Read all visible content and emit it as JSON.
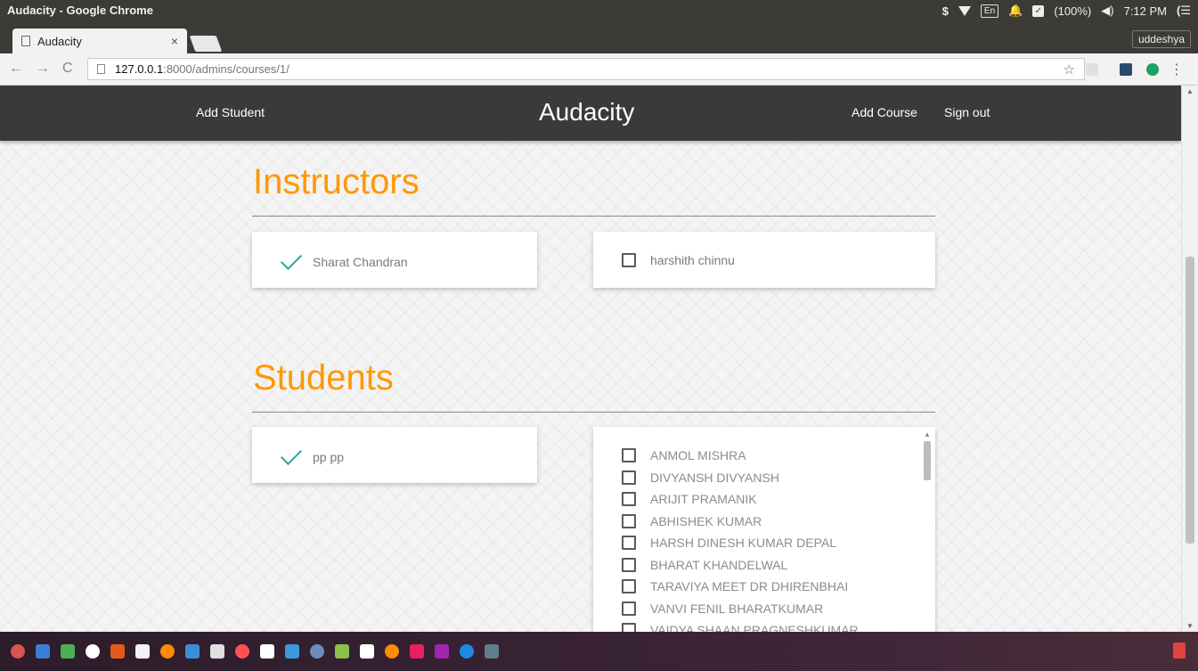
{
  "window": {
    "title": "Audacity - Google Chrome"
  },
  "tray": {
    "lang": "En",
    "battery": "(100%)",
    "volume_icon": "speaker-icon",
    "time": "7:12 PM"
  },
  "browser": {
    "tab_title": "Audacity",
    "tab_close": "×",
    "profile": "uddeshya",
    "url_host": "127.0.0.1",
    "url_rest": ":8000/admins/courses/1/",
    "star": "☆",
    "menu": "⋮"
  },
  "navbar": {
    "add_student": "Add Student",
    "brand": "Audacity",
    "add_course": "Add Course",
    "sign_out": "Sign out"
  },
  "instructors": {
    "title": "Instructors",
    "assigned": "Sharat Chandran",
    "available": "harshith chinnu"
  },
  "students": {
    "title": "Students",
    "assigned": "pp pp",
    "available": [
      "ANMOL MISHRA",
      "DIVYANSH DIVYANSH",
      "ARIJIT PRAMANIK",
      "ABHISHEK KUMAR",
      "HARSH DINESH KUMAR DEPAL",
      "BHARAT KHANDELWAL",
      "TARAVIYA MEET DR DHIRENBHAI",
      "VANVI FENIL BHARATKUMAR",
      "VAIDYA SHAAN PRAGNESHKUMAR"
    ]
  },
  "dock_colors": [
    "#d9534f",
    "#3b7dd8",
    "#4caf50",
    "#ffffff",
    "#e55a1c",
    "#f2f2f2",
    "#ff8a00",
    "#3c8dd9",
    "#e0e0e0",
    "#ff5252",
    "#ffffff",
    "#3a9ad9",
    "#6a8cbe",
    "#8bc34a",
    "#ffffff",
    "#ff8c00",
    "#e91e63",
    "#9c27b0",
    "#1e88e5",
    "#607d8b"
  ]
}
